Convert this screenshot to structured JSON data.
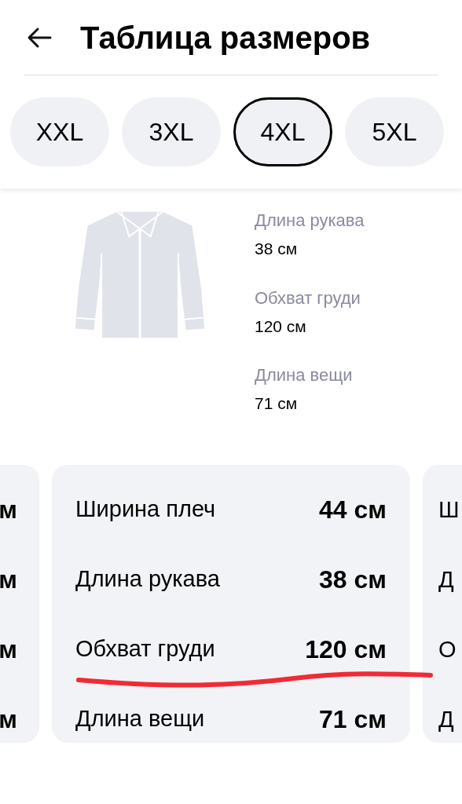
{
  "header": {
    "title": "Таблица размеров"
  },
  "sizes": [
    {
      "label": "XXL",
      "selected": false
    },
    {
      "label": "3XL",
      "selected": false
    },
    {
      "label": "4XL",
      "selected": true
    },
    {
      "label": "5XL",
      "selected": false
    }
  ],
  "garment_measurements": [
    {
      "label": "Длина рукава",
      "value": "38 см"
    },
    {
      "label": "Обхват груди",
      "value": "120 см"
    },
    {
      "label": "Длина вещи",
      "value": "71 см"
    }
  ],
  "cards": [
    {
      "rows": [
        {
          "value": "м"
        },
        {
          "value": "м"
        },
        {
          "value": "м"
        },
        {
          "value": "м"
        }
      ]
    },
    {
      "rows": [
        {
          "label": "Ширина плеч",
          "value": "44 см"
        },
        {
          "label": "Длина рукава",
          "value": "38 см"
        },
        {
          "label": "Обхват груди",
          "value": "120 см"
        },
        {
          "label": "Длина вещи",
          "value": "71 см"
        }
      ]
    },
    {
      "rows": [
        {
          "label": "Ш"
        },
        {
          "label": "Д"
        },
        {
          "label": "О"
        },
        {
          "label": "Д"
        }
      ]
    }
  ]
}
